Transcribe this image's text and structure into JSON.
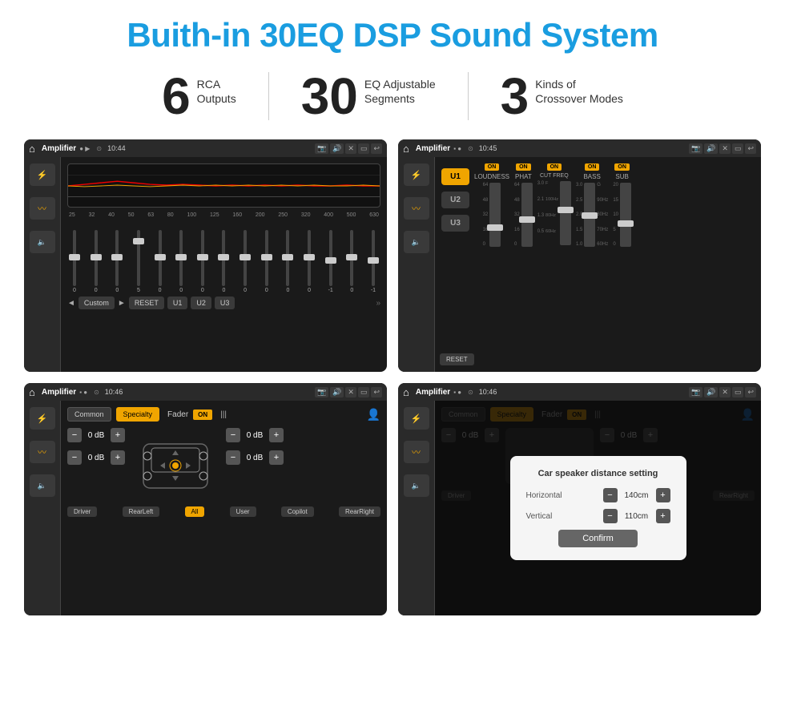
{
  "page": {
    "title": "Buith-in 30EQ DSP Sound System",
    "stats": [
      {
        "number": "6",
        "label": "RCA\nOutputs"
      },
      {
        "number": "30",
        "label": "EQ Adjustable\nSegments"
      },
      {
        "number": "3",
        "label": "Kinds of\nCrossover Modes"
      }
    ],
    "screens": [
      {
        "id": "eq-screen",
        "status_bar": {
          "home": "⌂",
          "app": "Amplifier",
          "mode_icons": "● ▶",
          "pin": "⊙",
          "time": "10:44"
        },
        "freq_labels": [
          "25",
          "32",
          "40",
          "50",
          "63",
          "80",
          "100",
          "125",
          "160",
          "200",
          "250",
          "320",
          "400",
          "500",
          "630"
        ],
        "slider_values": [
          "0",
          "0",
          "0",
          "5",
          "0",
          "0",
          "0",
          "0",
          "0",
          "0",
          "0",
          "0",
          "-1",
          "0",
          "-1"
        ],
        "bottom_buttons": [
          "Custom",
          "RESET",
          "U1",
          "U2",
          "U3"
        ]
      },
      {
        "id": "crossover-screen",
        "status_bar": {
          "home": "⌂",
          "app": "Amplifier",
          "time": "10:45"
        },
        "u_buttons": [
          "U1",
          "U2",
          "U3"
        ],
        "labels": [
          "LOUDNESS",
          "PHAT",
          "CUT FREQ",
          "BASS",
          "SUB"
        ],
        "on_badges": [
          "ON",
          "ON",
          "ON",
          "ON",
          "ON"
        ],
        "reset_label": "RESET"
      },
      {
        "id": "fader-screen",
        "status_bar": {
          "home": "⌂",
          "app": "Amplifier",
          "time": "10:46"
        },
        "tabs": [
          "Common",
          "Specialty"
        ],
        "fader_label": "Fader",
        "on_label": "ON",
        "db_values": [
          "0 dB",
          "0 dB",
          "0 dB",
          "0 dB"
        ],
        "nav_buttons": [
          "Driver",
          "RearLeft",
          "All",
          "User",
          "Copilot",
          "RearRight"
        ]
      },
      {
        "id": "dialog-screen",
        "status_bar": {
          "home": "⌂",
          "app": "Amplifier",
          "time": "10:46"
        },
        "tabs": [
          "Common",
          "Specialty"
        ],
        "dialog": {
          "title": "Car speaker distance setting",
          "horizontal_label": "Horizontal",
          "horizontal_value": "140cm",
          "vertical_label": "Vertical",
          "vertical_value": "110cm",
          "confirm_label": "Confirm"
        },
        "db_values": [
          "0 dB",
          "0 dB"
        ]
      }
    ]
  }
}
